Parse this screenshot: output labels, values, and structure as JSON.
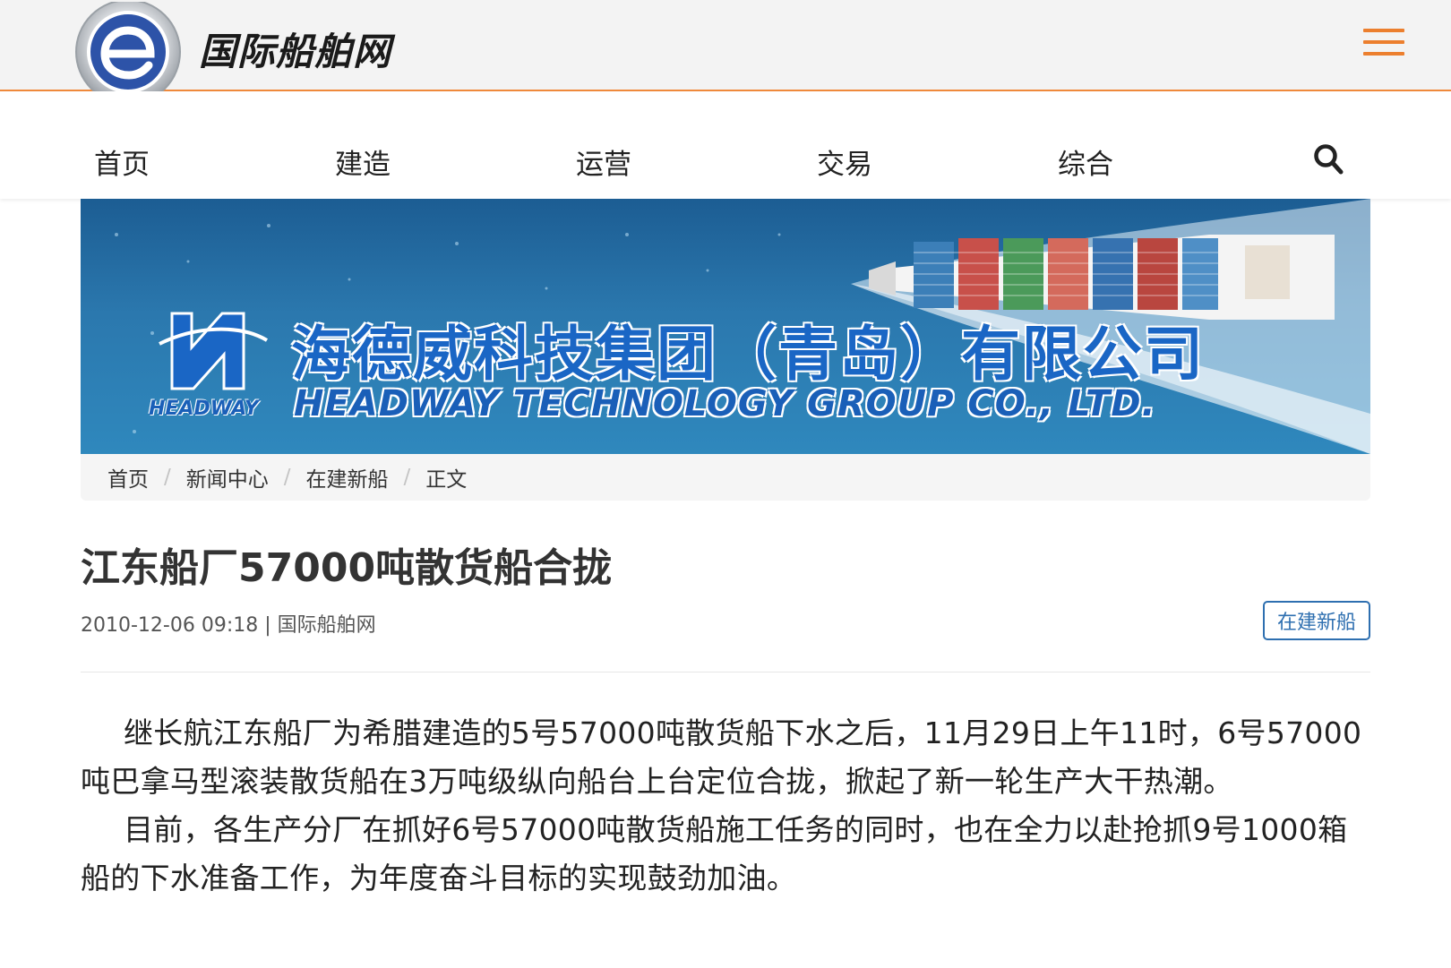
{
  "header": {
    "site_title": "国际船舶网",
    "logo_icon": "globe-e-icon",
    "menu_icon": "hamburger-menu-icon",
    "accent_color": "#ec7f2e"
  },
  "nav": {
    "items": [
      "首页",
      "建造",
      "运营",
      "交易",
      "综合"
    ],
    "search_icon": "search-icon"
  },
  "banner": {
    "company_cn": "海德威科技集团（青岛）有限公司",
    "company_en": "HEADWAY TECHNOLOGY GROUP CO., LTD.",
    "logo_word": "HEADWAY"
  },
  "breadcrumb": {
    "items": [
      "首页",
      "新闻中心",
      "在建新船",
      "正文"
    ],
    "separator": "/"
  },
  "article": {
    "title": "江东船厂57000吨散货船合拢",
    "meta": "2010-12-06 09:18 | 国际船舶网",
    "tag": "在建新船",
    "paragraphs": [
      "继长航江东船厂为希腊建造的5号57000吨散货船下水之后，11月29日上午11时，6号57000吨巴拿马型滚装散货船在3万吨级纵向船台上台定位合拢，掀起了新一轮生产大干热潮。",
      "目前，各生产分厂在抓好6号57000吨散货船施工任务的同时，也在全力以赴抢抓9号1000箱船的下水准备工作，为年度奋斗目标的实现鼓劲加油。"
    ]
  }
}
